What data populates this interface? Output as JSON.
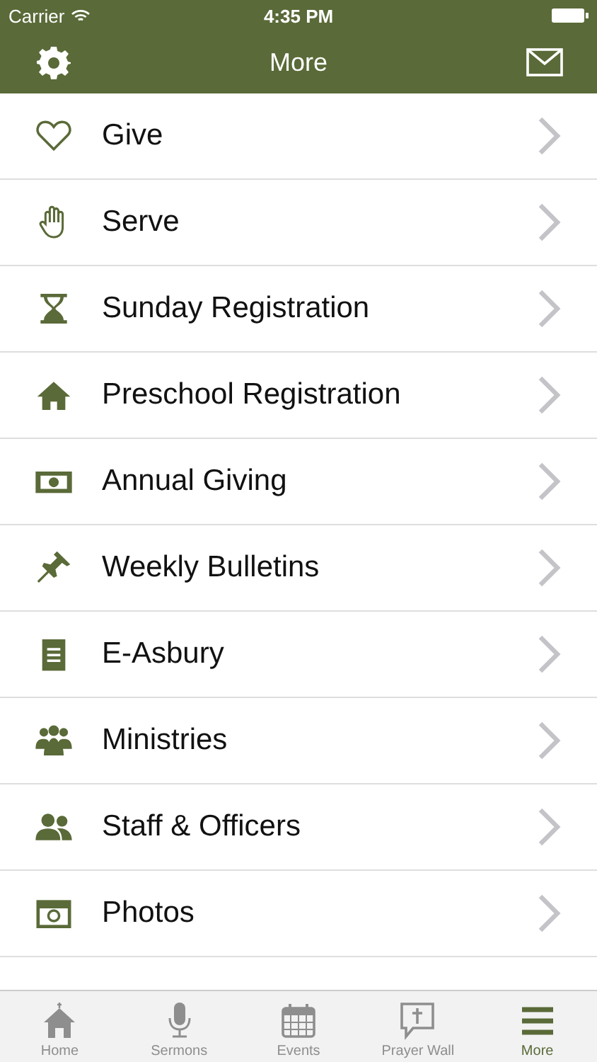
{
  "status_bar": {
    "carrier": "Carrier",
    "time": "4:35 PM"
  },
  "nav_bar": {
    "title": "More"
  },
  "menu": [
    {
      "label": "Give"
    },
    {
      "label": "Serve"
    },
    {
      "label": "Sunday Registration"
    },
    {
      "label": "Preschool Registration"
    },
    {
      "label": "Annual Giving"
    },
    {
      "label": "Weekly Bulletins"
    },
    {
      "label": "E-Asbury"
    },
    {
      "label": "Ministries"
    },
    {
      "label": "Staff & Officers"
    },
    {
      "label": "Photos"
    }
  ],
  "tab_bar": [
    {
      "label": "Home",
      "selected": false
    },
    {
      "label": "Sermons",
      "selected": false
    },
    {
      "label": "Events",
      "selected": false
    },
    {
      "label": "Prayer Wall",
      "selected": false
    },
    {
      "label": "More",
      "selected": true
    }
  ]
}
